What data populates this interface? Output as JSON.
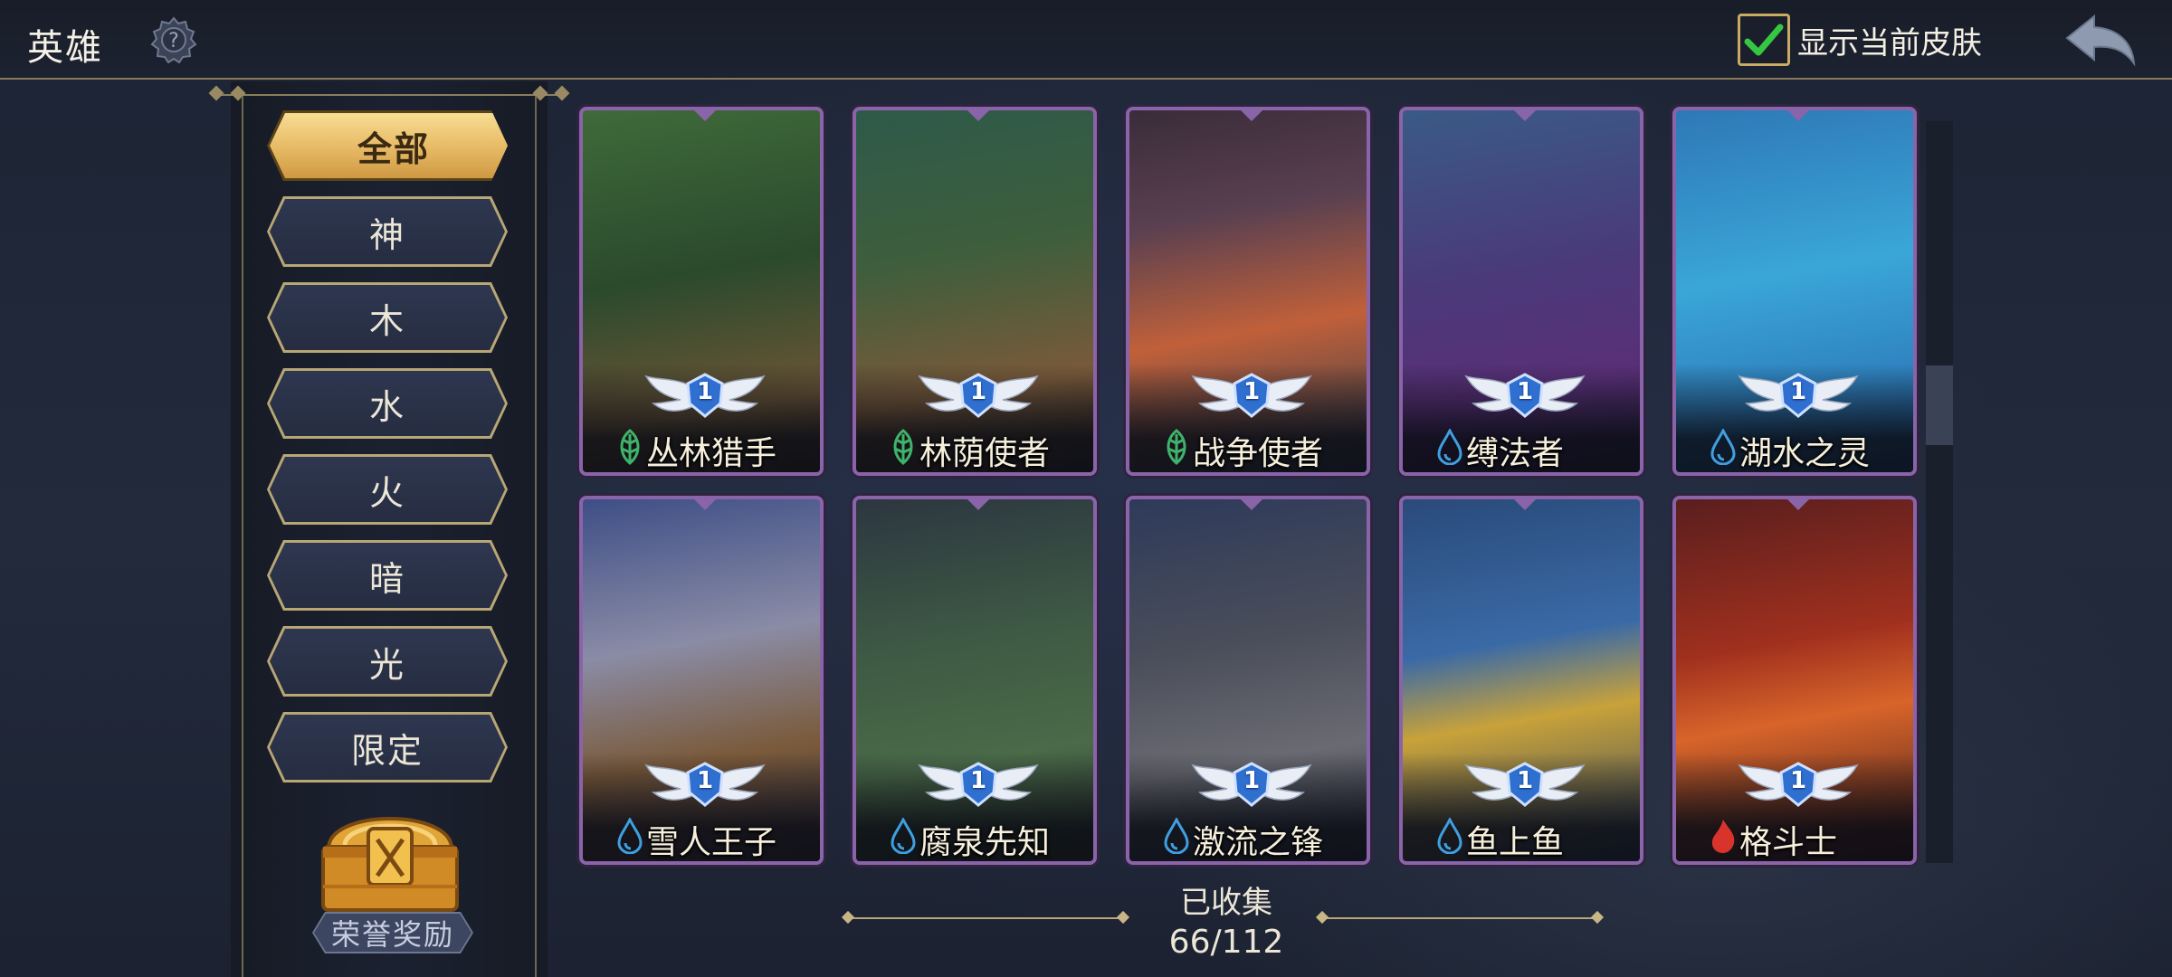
{
  "header": {
    "title": "英雄",
    "help_icon": "question-gear-icon",
    "show_skin_label": "显示当前皮肤",
    "show_skin_checked": true,
    "back_icon": "back-arrow-icon"
  },
  "filters": [
    {
      "label": "全部",
      "active": true
    },
    {
      "label": "神",
      "active": false
    },
    {
      "label": "木",
      "active": false
    },
    {
      "label": "水",
      "active": false
    },
    {
      "label": "火",
      "active": false
    },
    {
      "label": "暗",
      "active": false
    },
    {
      "label": "光",
      "active": false
    },
    {
      "label": "限定",
      "active": false
    }
  ],
  "reward": {
    "label": "荣誉奖励",
    "icon": "treasure-chest-icon"
  },
  "heroes": [
    {
      "name": "丛林猎手",
      "element": "wood",
      "rank": "1"
    },
    {
      "name": "林荫使者",
      "element": "wood",
      "rank": "1"
    },
    {
      "name": "战争使者",
      "element": "wood",
      "rank": "1"
    },
    {
      "name": "缚法者",
      "element": "water",
      "rank": "1"
    },
    {
      "name": "湖水之灵",
      "element": "water",
      "rank": "1"
    },
    {
      "name": "雪人王子",
      "element": "water",
      "rank": "1"
    },
    {
      "name": "腐泉先知",
      "element": "water",
      "rank": "1"
    },
    {
      "name": "激流之锋",
      "element": "water",
      "rank": "1"
    },
    {
      "name": "鱼上鱼",
      "element": "water",
      "rank": "1"
    },
    {
      "name": "格斗士",
      "element": "fire",
      "rank": "1"
    }
  ],
  "collection": {
    "label": "已收集",
    "value": "66/112"
  },
  "colors": {
    "gold": "#e7b964",
    "card_border": "#8a64a8",
    "wood": "#3fb36a",
    "water": "#3f9fe0",
    "fire": "#d9342b"
  }
}
